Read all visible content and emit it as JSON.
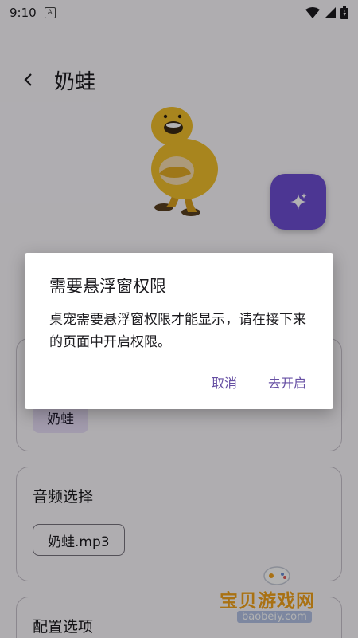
{
  "status_bar": {
    "time": "9:10",
    "notif": "A"
  },
  "header": {
    "title": "奶蛙"
  },
  "cards": {
    "card1": {
      "chip": "奶蛙"
    },
    "audio": {
      "title": "音频选择",
      "chip": "奶蛙.mp3"
    },
    "config": {
      "title": "配置选项"
    }
  },
  "dialog": {
    "title": "需要悬浮窗权限",
    "message": "桌宠需要悬浮窗权限才能显示，请在接下来的页面中开启权限。",
    "cancel": "取消",
    "confirm": "去开启"
  },
  "watermark": {
    "text": "宝贝游戏网",
    "url": "baobeiy.com"
  },
  "colors": {
    "accent": "#6d4ed3",
    "button_text": "#6750a4",
    "watermark": "#f2a21c"
  },
  "icons": [
    "wifi-icon",
    "signal-icon",
    "battery-icon",
    "back-arrow-icon",
    "sparkle-icon"
  ]
}
